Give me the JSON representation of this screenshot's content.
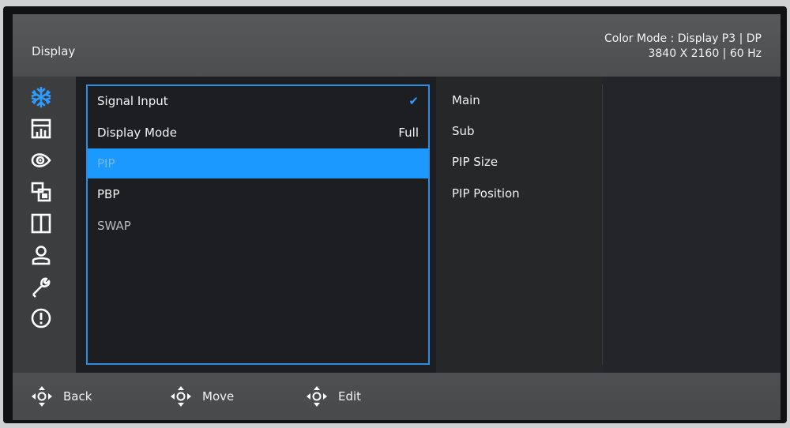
{
  "header": {
    "title": "Display",
    "info_line1": "Color Mode  : Display P3 |  DP",
    "info_line2": "3840 X 2160  |   60 Hz"
  },
  "sidebar": {
    "icons": [
      "input-snowflake-icon",
      "picture-icon",
      "color-icon",
      "pip-icon",
      "layout-icon",
      "user-icon",
      "wrench-icon",
      "info-icon"
    ],
    "active_icon": "input-snowflake-icon",
    "accent_color": "#2f8de4"
  },
  "menu": {
    "items": [
      {
        "label": "Signal Input",
        "value": "✔",
        "state": "normal"
      },
      {
        "label": "Display Mode",
        "value": "Full",
        "state": "normal"
      },
      {
        "label": "PIP",
        "value": "",
        "state": "selected"
      },
      {
        "label": "PBP",
        "value": "",
        "state": "normal"
      },
      {
        "label": "SWAP",
        "value": "",
        "state": "disabled"
      }
    ],
    "highlight_color": "#1b99ff"
  },
  "submenu": {
    "items": [
      "Main",
      "Sub",
      "PIP Size",
      "PIP Position"
    ]
  },
  "footer": {
    "back_label": "Back",
    "move_label": "Move",
    "edit_label": "Edit",
    "icon": "joystick-icon"
  }
}
